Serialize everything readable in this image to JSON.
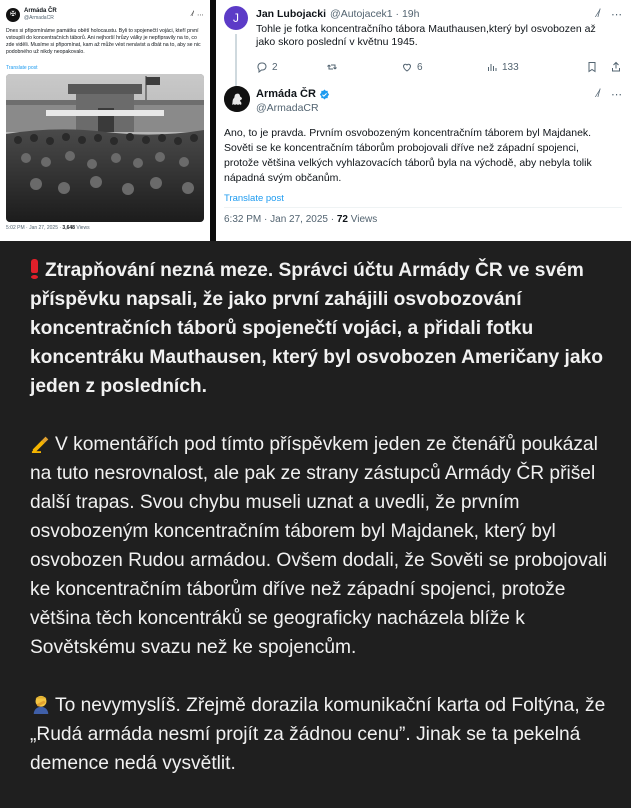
{
  "left_tweet": {
    "avatar_glyph": "✠",
    "name": "Armáda ČR",
    "handle": "@ArmadaCR",
    "text": "Dnes si připomínáme památku obětí holocaustu. Byli to spojenečtí vojáci, kteří první vstoupili do koncentračních táborů. Ani nejhorší hrůzy války je nepřipravily na to, co zde viděli. Musíme si připomínat, kam až může vést nenávist a dbát na to, aby se nic podobného už nikdy neopakovalo.",
    "translate": "Translate post",
    "time": "5:02 PM · Jan 27, 2025 · ",
    "views": "3,648",
    "views_suffix": " Views",
    "photo_description_icon": "mauthausen-photo"
  },
  "reply": {
    "avatar_letter": "J",
    "name": "Jan Lubojacki",
    "handle": "@Autojacek1 · 19h",
    "text": "Tohle je fotka koncentračního tábora Mauthausen,který byl osvobozen až jako skoro poslední v květnu 1945.",
    "replies": "2",
    "reposts": "",
    "likes": "6",
    "views": "133"
  },
  "main_tweet": {
    "name": "Armáda ČR",
    "handle": "@ArmadaCR",
    "text": "Ano, to je pravda. Prvním osvobozeným koncentračním táborem byl Majdanek. Sověti se ke koncentračním táborům probojovali dříve než západní spojenci, protože většina velkých vyhlazovacích táborů byla na východě, aby nebyla tolik nápadná svým občanům.",
    "translate": "Translate post",
    "time": "6:32 PM · Jan 27, 2025 · ",
    "views": "72",
    "views_suffix": " Views"
  },
  "post": {
    "p1": "Ztrapňování nezná meze. Správci účtu Armády ČR ve svém příspěvku napsali, že jako první zahájili osvobozování koncentračních táborů spojenečtí vojáci, a přidali fotku koncentráku Mauthausen, který byl osvobozen Američany jako jeden z posledních.",
    "p2": "V komentářích pod tímto příspěvkem jeden ze čtenářů poukázal na tuto nesrovnalost, ale pak ze strany zástupců Armády ČR přišel další trapas. Svou chybu museli uznat a uvedli, že prvním osvobozeným koncentračním táborem byl Majdanek, který byl osvobozen Rudou armádou. Ovšem dodali, že Sověti se probojovali ke koncentračním táborům dříve než západní spojenci, protože většina těch koncentráků se geograficky nacházela blíže k Sovětskému svazu než ke spojencům.",
    "p3": "To nevymyslíš. Zřejmě dorazila komunikační karta od Foltýna, že „Rudá armáda nesmí projít za žádnou cenu”. Jinak se ta pekelná demence nedá vysvětlit."
  },
  "colors": {
    "background": "#1f1f1f",
    "text": "#f1f1f1",
    "accent": "#1d9bf0",
    "exclamation": "#e0202a"
  },
  "icons": [
    "red-exclamation-icon",
    "writing-hand-icon",
    "facepalm-icon",
    "verified-badge-icon",
    "grok-icon",
    "more-icon",
    "reply-icon",
    "repost-icon",
    "like-icon",
    "views-icon",
    "bookmark-icon",
    "share-icon"
  ]
}
